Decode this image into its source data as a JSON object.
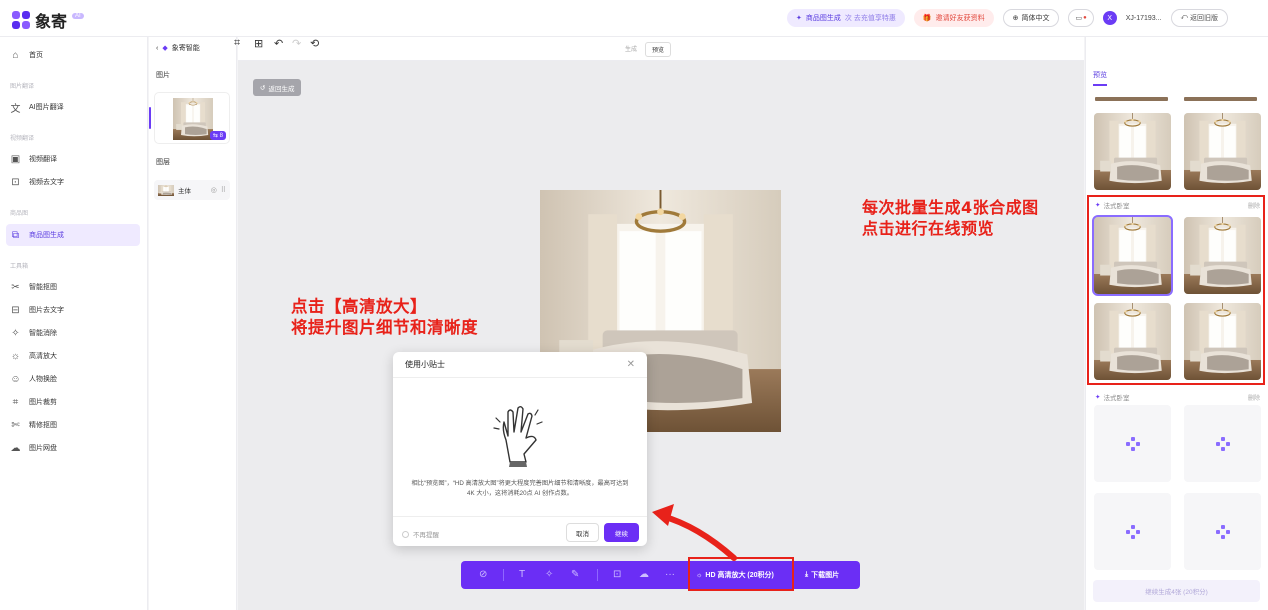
{
  "app": {
    "logo_text": "象寄",
    "logo_badge": "AI"
  },
  "topbar": {
    "product_gen_label": "商品图生成",
    "product_gen_sub": "次 去充值享特惠",
    "invite_label": "邀请好友获资料",
    "language_label": "简体中文",
    "avatar_letter": "X",
    "user_id": "XJ-17193...",
    "back_old_label": "返回旧版"
  },
  "sidebar": {
    "home": "首页",
    "section_image_translate": "图片翻译",
    "ai_image_translate": "AI图片翻译",
    "section_video_translate": "视频翻译",
    "video_translate": "视频翻译",
    "video_remove_text": "视频去文字",
    "section_product": "商品图",
    "product_image_gen": "商品图生成",
    "section_toolbox": "工具箱",
    "smart_cutout": "智能抠图",
    "image_remove_text": "图片去文字",
    "smart_erase": "智能消除",
    "hd_upscale": "高清放大",
    "face_swap": "人物换脸",
    "image_crop": "图片裁剪",
    "fine_cutout": "精修抠图",
    "image_cloud": "图片网盘"
  },
  "layers_panel": {
    "image_label": "图片",
    "badge": "8",
    "layers_label": "图层",
    "layer_name": "主体"
  },
  "canvas": {
    "back_label": "象寄智能",
    "tab_generate": "生成",
    "tab_preview": "预览",
    "back_generate": "返回生成"
  },
  "annotations": {
    "right_line1": "每次批量生成4张合成图",
    "right_line2": "点击进行在线预览",
    "left_line1": "点击【高清放大】",
    "left_line2": "将提升图片细节和清晰度"
  },
  "dialog": {
    "title": "使用小贴士",
    "text": "相比“预览图”，“HD 高清放大图”将更大程度完善图片细节和清晰度，最高可达到 4K 大小，这将消耗20点 AI 创作点数。",
    "no_remind": "不再提醒",
    "cancel": "取消",
    "continue": "继续"
  },
  "bottom_bar": {
    "hd_label": "HD 高清放大 (20积分)",
    "download_label": "下载图片"
  },
  "right_panel": {
    "tab": "预览",
    "group1_name": "法式卧室",
    "group1_action": "删除",
    "group2_name": "法式卧室",
    "group2_action": "删除",
    "more_button": "继续生成4张 (20积分)"
  },
  "colors": {
    "accent": "#6b2ef5",
    "annotation": "#e8221a"
  }
}
